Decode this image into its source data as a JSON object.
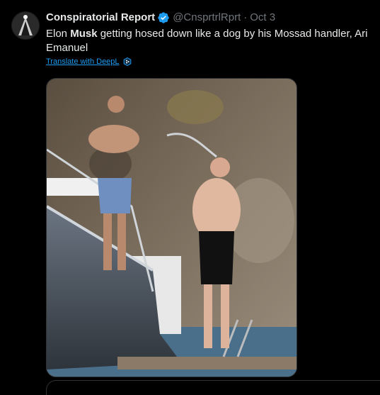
{
  "tweet": {
    "author": {
      "display_name": "Conspiratorial Report",
      "handle": "@CnsprtrlRprt",
      "verified": true
    },
    "separator": "·",
    "date": "Oct 3",
    "text_parts": {
      "before": "Elon ",
      "bold": "Musk",
      "after": " getting hosed down like a dog by his Mossad handler, Ari Emanuel"
    },
    "translate_label": "Translate with DeepL",
    "media_alt": "Photo"
  },
  "icons": {
    "verified": "verified-badge-icon",
    "translate": "deepl-icon"
  },
  "colors": {
    "background": "#000000",
    "text": "#e7e9ea",
    "secondary": "#71767b",
    "link": "#1d9bf0",
    "border": "#2f3336"
  }
}
